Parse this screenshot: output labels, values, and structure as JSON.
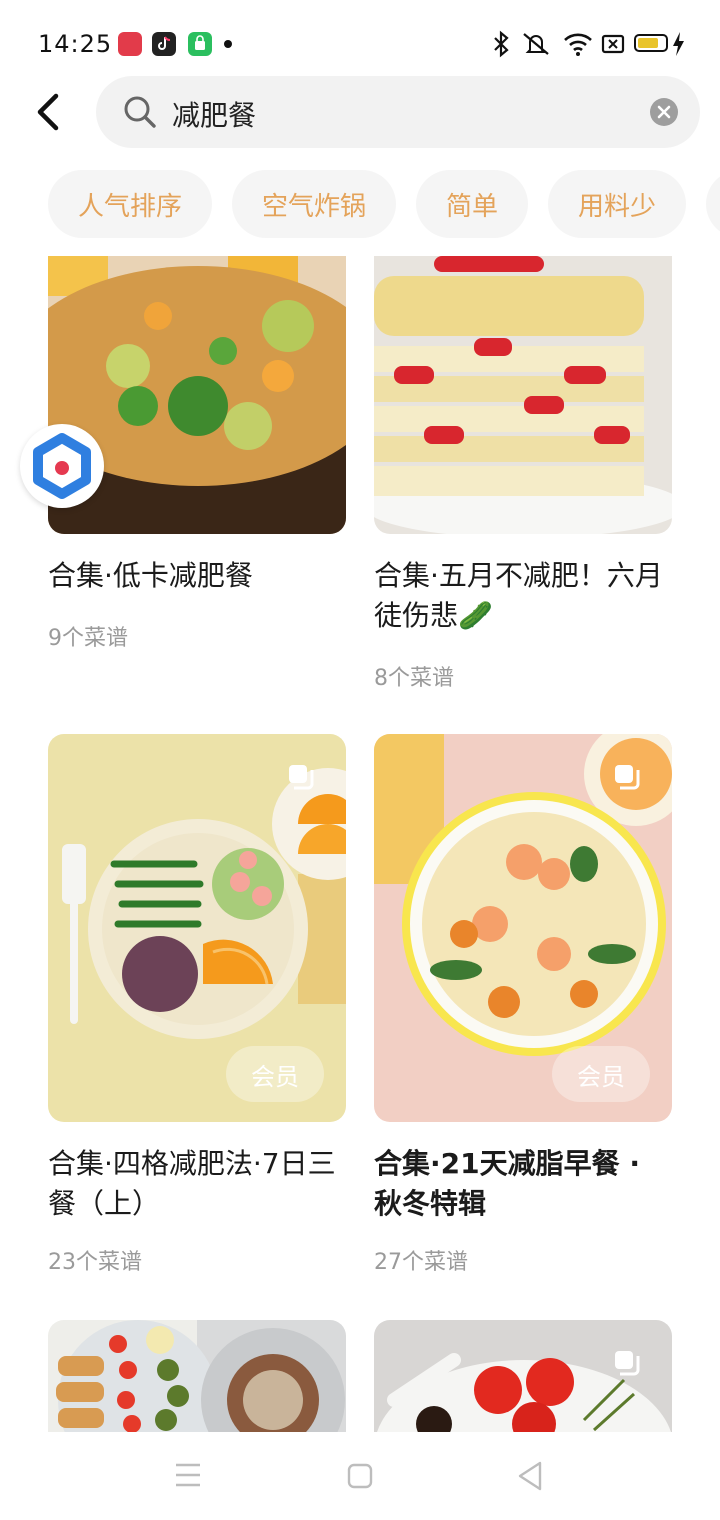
{
  "status_bar": {
    "time": "14:25",
    "app_icons": [
      "screen-record-icon",
      "tiktok-icon",
      "shop-icon"
    ],
    "system_icons": [
      "bluetooth-icon",
      "mute-icon",
      "wifi-icon",
      "sim-icon",
      "battery-icon",
      "charging-icon"
    ],
    "battery_color": "#e9c42b"
  },
  "search": {
    "query": "减肥餐"
  },
  "filters": [
    "人气排序",
    "空气炸锅",
    "简单",
    "用料少"
  ],
  "cards": [
    {
      "title": "合集·低卡减肥餐",
      "count": "9个菜谱",
      "vip": ""
    },
    {
      "title": "合集·五月不减肥！六月徒伤悲🥒",
      "count": "8个菜谱",
      "vip": ""
    },
    {
      "title": "合集·四格减肥法·7日三餐（上）",
      "count": "23个菜谱",
      "vip": "会员"
    },
    {
      "title": "合集·21天减脂早餐 · 秋冬特辑",
      "count": "27个菜谱",
      "vip": "会员"
    }
  ],
  "colors": {
    "chip_text": "#e4a35a",
    "chip_bg": "#f5f5f5",
    "search_bg": "#f2f2f2"
  }
}
